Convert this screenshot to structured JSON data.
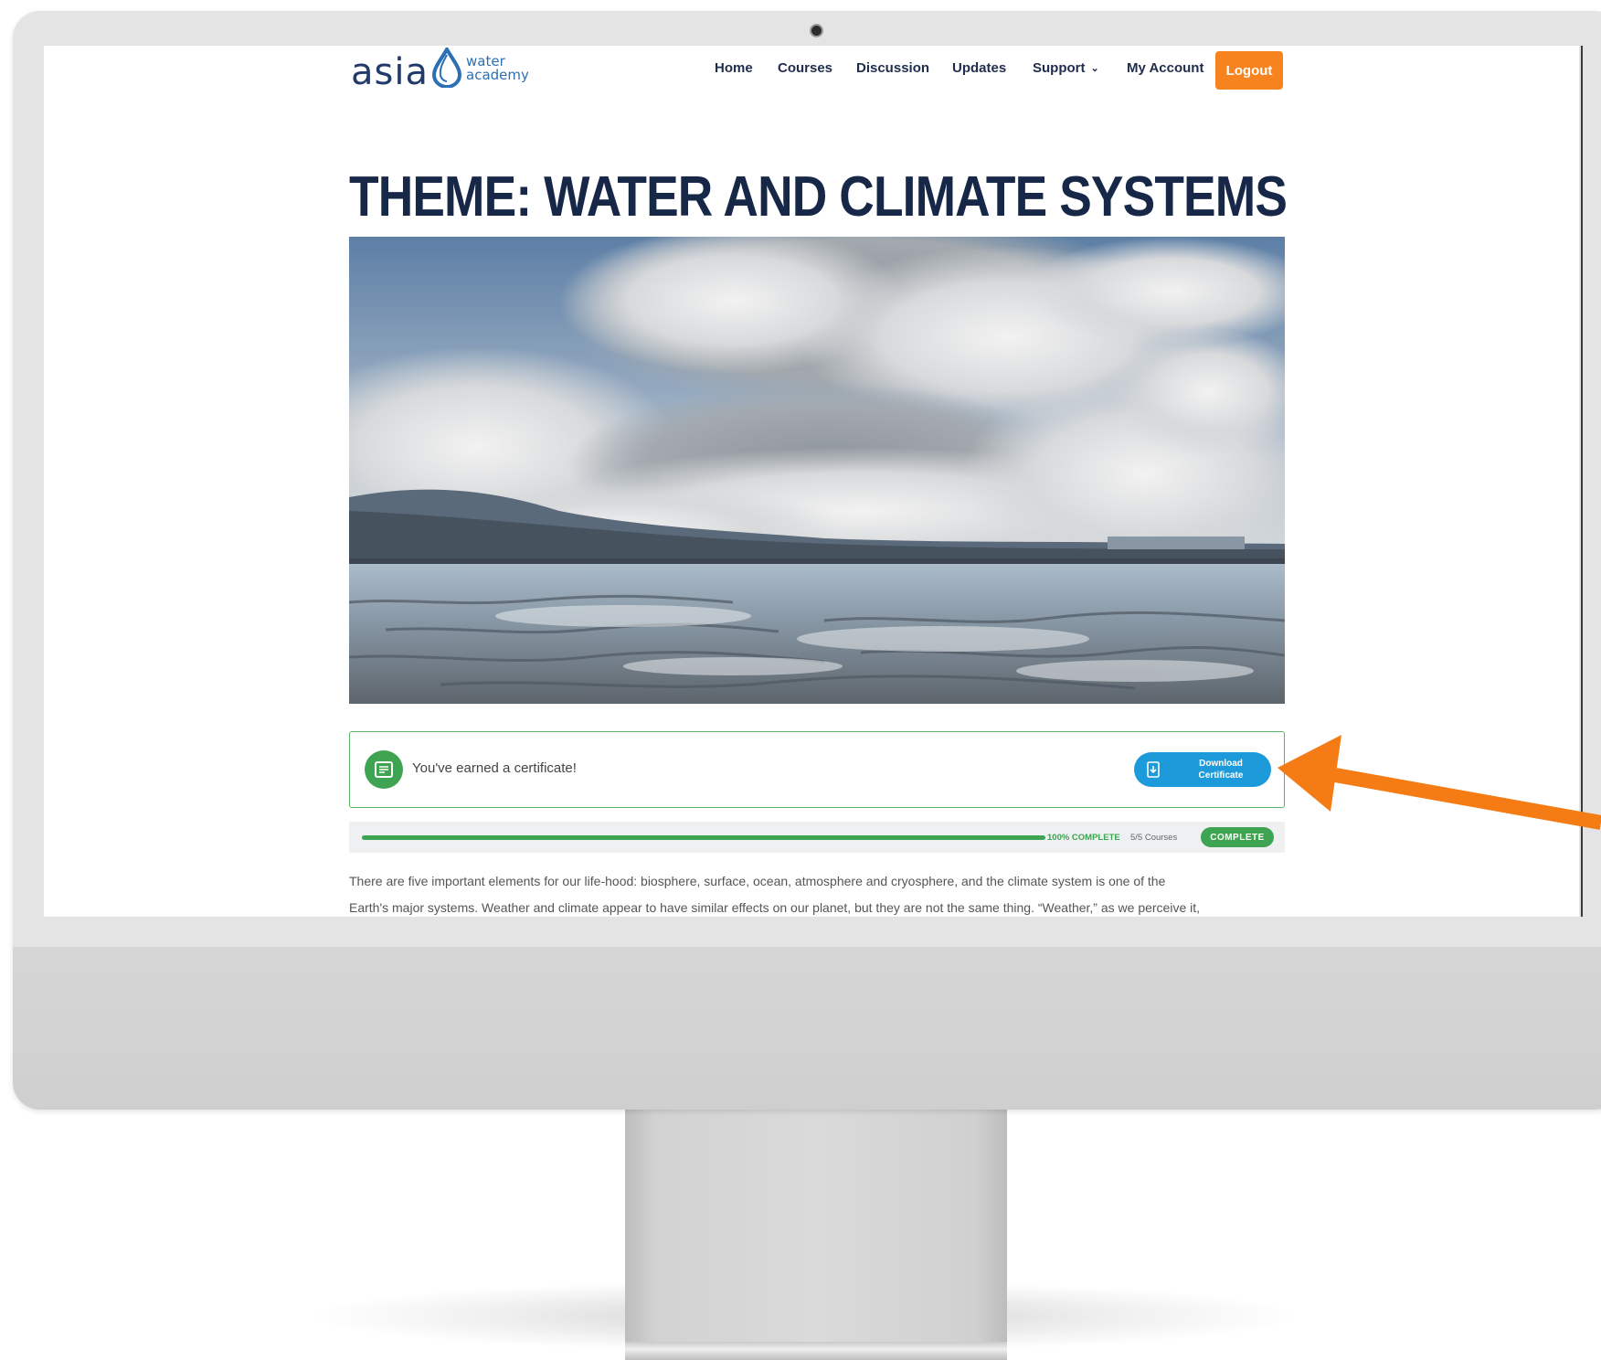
{
  "header": {
    "logo": {
      "main": "asia",
      "sub_line1": "water",
      "sub_line2": "academy"
    },
    "nav": [
      {
        "label": "Home"
      },
      {
        "label": "Courses"
      },
      {
        "label": "Discussion"
      },
      {
        "label": "Updates"
      },
      {
        "label": "Support",
        "has_dropdown": true
      },
      {
        "label": "My Account"
      }
    ],
    "logout_label": "Logout"
  },
  "page": {
    "title": "THEME: WATER AND CLIMATE SYSTEMS",
    "hero_image": "cloudy-sky-tidal-flats-landscape"
  },
  "certificate": {
    "message": "You've earned a certificate!",
    "button_line1": "Download",
    "button_line2": "Certificate",
    "icon": "certificate-icon",
    "button_icon": "download-icon"
  },
  "progress": {
    "percent_label": "100% COMPLETE",
    "count_label": "5/5 Courses",
    "badge": "COMPLETE",
    "fraction": 1.0
  },
  "body": {
    "line1": "There are five important elements for our life-hood: biosphere, surface, ocean, atmosphere and cryosphere, and the climate system is one of the",
    "line2": "Earth's major systems. Weather and climate appear to have similar effects on our planet, but they are not the same thing. “Weather,” as we perceive it,"
  },
  "colors": {
    "brand_navy": "#172747",
    "logout_orange": "#f7831e",
    "success_green": "#3fa451",
    "button_blue": "#1d9ad9",
    "annotation_arrow": "#f57c14"
  }
}
